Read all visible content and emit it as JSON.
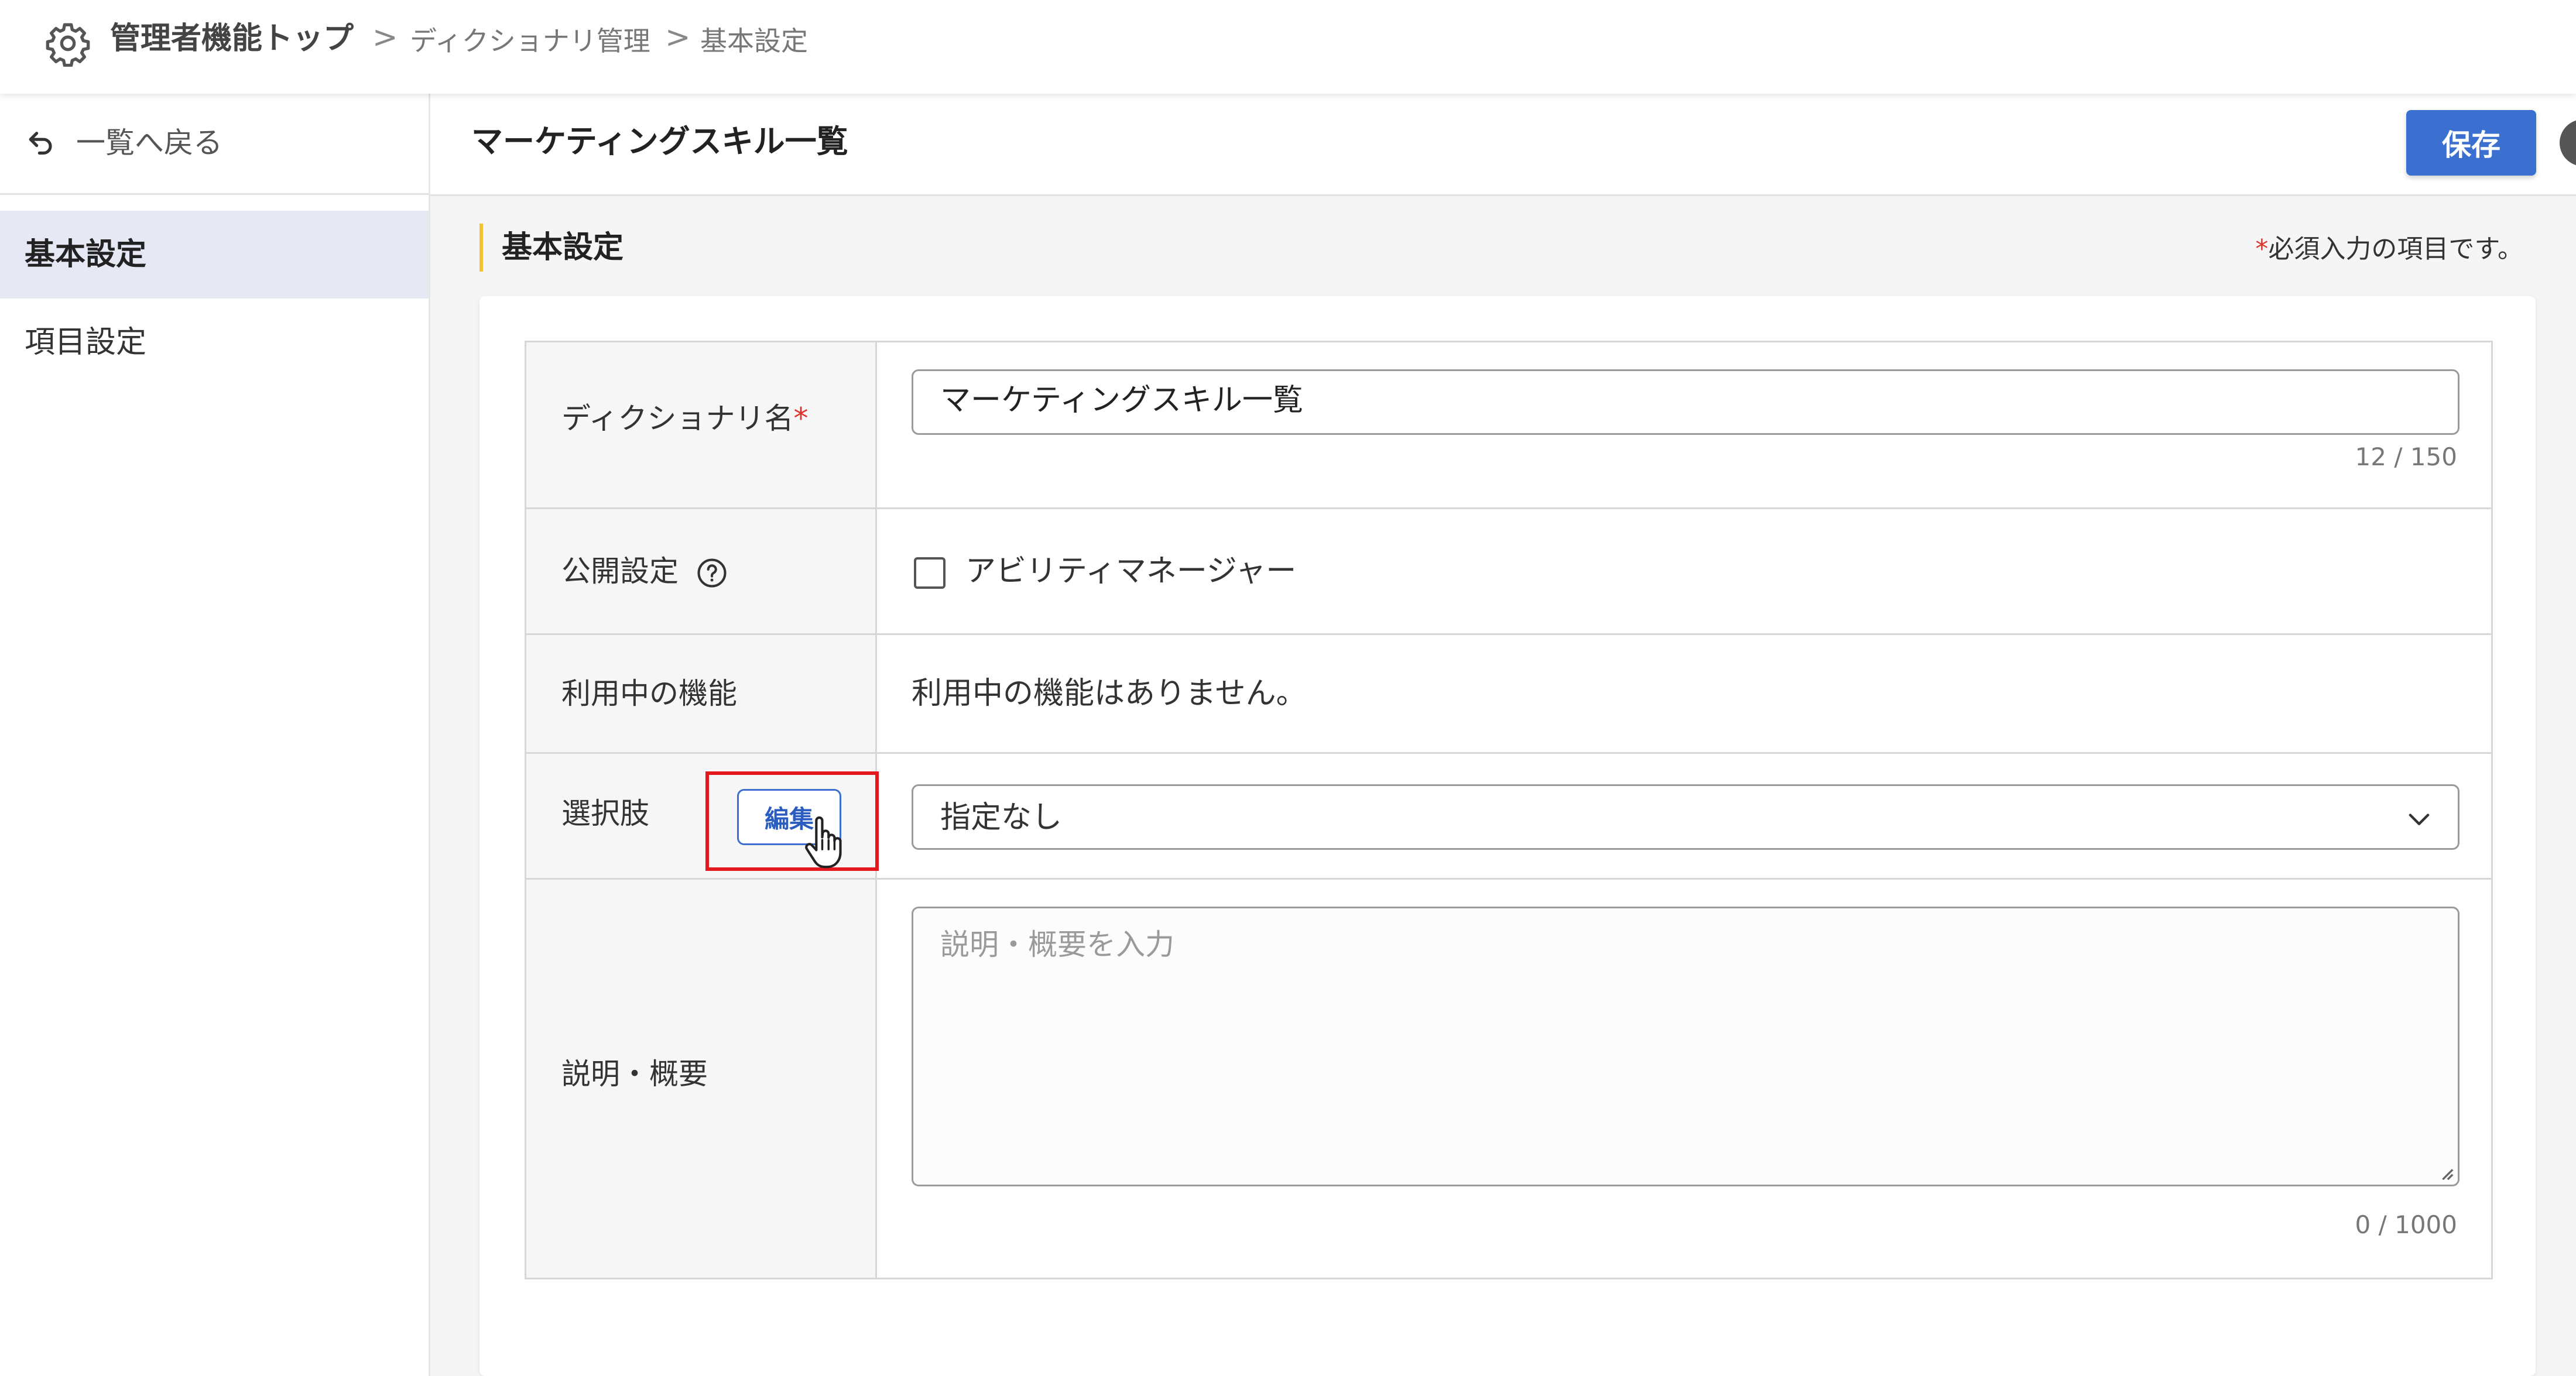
{
  "breadcrumb": {
    "top": "管理者機能トップ",
    "sep": ">",
    "middle": "ディクショナリ管理",
    "current": "基本設定"
  },
  "sidebar": {
    "back_label": "一覧へ戻る",
    "items": [
      {
        "label": "基本設定",
        "active": true
      },
      {
        "label": "項目設定",
        "active": false
      }
    ]
  },
  "header": {
    "title": "マーケティングスキル一覧",
    "save_label": "保存"
  },
  "section": {
    "title": "基本設定",
    "required_star": "*",
    "required_note": "必須入力の項目です。"
  },
  "form": {
    "name": {
      "label": "ディクショナリ名",
      "required": "*",
      "value": "マーケティングスキル一覧",
      "counter": "12 / 150"
    },
    "visibility": {
      "label": "公開設定",
      "option_label": "アビリティマネージャー",
      "checked": false
    },
    "in_use": {
      "label": "利用中の機能",
      "value": "利用中の機能はありません。"
    },
    "choices": {
      "label": "選択肢",
      "edit_label": "編集",
      "selected": "指定なし"
    },
    "description": {
      "label": "説明・概要",
      "placeholder": "説明・概要を入力",
      "counter": "0 / 1000"
    }
  },
  "colors": {
    "accent": "#3b6fd0",
    "section_bar": "#f2c230",
    "required": "#d9342b",
    "highlight_box": "#e4181f",
    "active_nav_bg": "#e6e9f4"
  },
  "icons": [
    "gear-icon",
    "undo-arrow-icon",
    "help-circle-icon",
    "chevron-down-icon",
    "hand-cursor-icon"
  ]
}
